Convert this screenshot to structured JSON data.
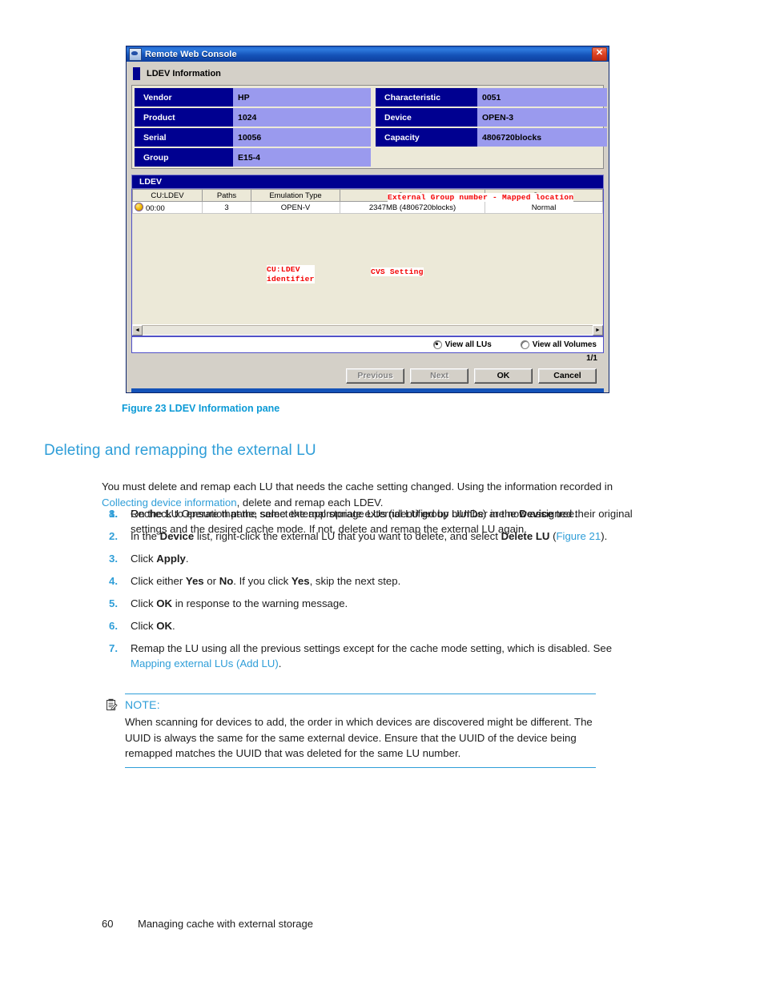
{
  "figure": {
    "window": {
      "title": "Remote Web Console",
      "icon": "ie-document-icon",
      "close_label": "✕",
      "pane_title": "LDEV Information",
      "info_left": [
        {
          "label": "Vendor",
          "value": "HP"
        },
        {
          "label": "Product",
          "value": "1024"
        },
        {
          "label": "Serial",
          "value": "10056"
        },
        {
          "label": "Group",
          "value": "E15-4"
        }
      ],
      "info_right": [
        {
          "label": "Characteristic",
          "value": "0051"
        },
        {
          "label": "Device",
          "value": "OPEN-3"
        },
        {
          "label": "Capacity",
          "value": "4806720blocks"
        }
      ],
      "ldev_section_title": "LDEV",
      "table": {
        "headers": [
          "CU:LDEV",
          "Paths",
          "Emulation Type",
          "Capacity",
          "Status"
        ],
        "rows": [
          {
            "culdev": "00:00",
            "paths": "3",
            "emulation": "OPEN-V",
            "capacity": "2347MB (4806720blocks)",
            "status": "Normal"
          }
        ]
      },
      "radios": [
        {
          "label": "View all LUs",
          "selected": true
        },
        {
          "label": "View all Volumes",
          "selected": false
        }
      ],
      "pager": "1/1",
      "buttons": [
        {
          "label": "Previous",
          "disabled": true
        },
        {
          "label": "Next",
          "disabled": true
        },
        {
          "label": "OK",
          "disabled": false
        },
        {
          "label": "Cancel",
          "disabled": false
        }
      ],
      "scrollbar": {
        "left_arrow": "◄",
        "right_arrow": "►"
      }
    },
    "annotations": {
      "group": "External Group number - Mapped location",
      "culdev_line1": "CU:LDEV",
      "culdev_line2": "identifier",
      "cvs": "CVS Setting"
    },
    "caption": "Figure 23 LDEV Information pane"
  },
  "document": {
    "heading": "Deleting and remapping the external LU",
    "intro": {
      "part1": "You must delete and remap each LU that needs the cache setting changed. Using the information recorded in ",
      "link": "Collecting device information",
      "part2": ", delete and remap each LDEV."
    },
    "steps": [
      {
        "num": "1.",
        "segments": [
          {
            "t": "On the LU Operation pane, select the appropriate external LU group number in the ",
            "s": "plain"
          },
          {
            "t": "Device",
            "s": "bold"
          },
          {
            "t": " tree.",
            "s": "plain"
          }
        ]
      },
      {
        "num": "2.",
        "segments": [
          {
            "t": "In the ",
            "s": "plain"
          },
          {
            "t": "Device",
            "s": "bold"
          },
          {
            "t": " list, right-click the external LU that you want to delete, and select ",
            "s": "plain"
          },
          {
            "t": "Delete LU",
            "s": "bold"
          },
          {
            "t": " (",
            "s": "plain"
          },
          {
            "t": "Figure 21",
            "s": "link"
          },
          {
            "t": ").",
            "s": "plain"
          }
        ]
      },
      {
        "num": "3.",
        "segments": [
          {
            "t": "Click ",
            "s": "plain"
          },
          {
            "t": "Apply",
            "s": "bold"
          },
          {
            "t": ".",
            "s": "plain"
          }
        ]
      },
      {
        "num": "4.",
        "segments": [
          {
            "t": "Click either ",
            "s": "plain"
          },
          {
            "t": "Yes",
            "s": "bold"
          },
          {
            "t": " or ",
            "s": "plain"
          },
          {
            "t": "No",
            "s": "bold"
          },
          {
            "t": ". If you click ",
            "s": "plain"
          },
          {
            "t": "Yes",
            "s": "bold"
          },
          {
            "t": ", skip the next step.",
            "s": "plain"
          }
        ]
      },
      {
        "num": "5.",
        "segments": [
          {
            "t": "Click ",
            "s": "plain"
          },
          {
            "t": "OK",
            "s": "bold"
          },
          {
            "t": " in response to the warning message.",
            "s": "plain"
          }
        ]
      },
      {
        "num": "6.",
        "segments": [
          {
            "t": "Click ",
            "s": "plain"
          },
          {
            "t": "OK",
            "s": "bold"
          },
          {
            "t": ".",
            "s": "plain"
          }
        ]
      },
      {
        "num": "7.",
        "segments": [
          {
            "t": "Remap the LU using all the previous settings except for the cache mode setting, which is disabled. See ",
            "s": "plain"
          },
          {
            "t": "Mapping external LUs (Add LU)",
            "s": "link"
          },
          {
            "t": ".",
            "s": "plain"
          }
        ]
      }
    ],
    "note": {
      "icon": "note-clipboard-icon",
      "label": "NOTE:",
      "body": "When scanning for devices to add, the order in which devices are discovered might be different. The UUID is always the same for the same external device. Ensure that the UUID of the device being remapped matches the UUID that was deleted for the same LU number."
    },
    "step8": {
      "num": "8.",
      "text": "Recheck to ensure that the same external storage LUs (identified by UUIDs) are now assigned their original settings and the desired cache mode. If not, delete and remap the external LU again."
    },
    "footer": {
      "page_number": "60",
      "chapter": "Managing cache with external storage"
    }
  },
  "colors": {
    "accent_blue": "#2f9ed8",
    "caption_blue": "#0b9ad6",
    "dialog_navy": "#000090",
    "annotation_red": "#f40000",
    "value_lavender": "#9a9aee"
  }
}
